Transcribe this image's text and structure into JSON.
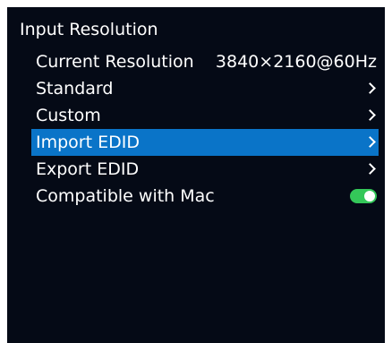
{
  "menu": {
    "title": "Input Resolution",
    "items": [
      {
        "label": "Current Resolution",
        "value": "3840×2160@60Hz"
      },
      {
        "label": "Standard"
      },
      {
        "label": "Custom"
      },
      {
        "label": "Import EDID",
        "selected": true
      },
      {
        "label": "Export EDID"
      },
      {
        "label": "Compatible with Mac",
        "toggle_on": true
      }
    ]
  },
  "colors": {
    "background": "#050a16",
    "selection": "#0a74c8",
    "toggle_on": "#34c759",
    "text": "#ffffff"
  },
  "icons": [
    "chevron-right-icon",
    "toggle-switch"
  ]
}
